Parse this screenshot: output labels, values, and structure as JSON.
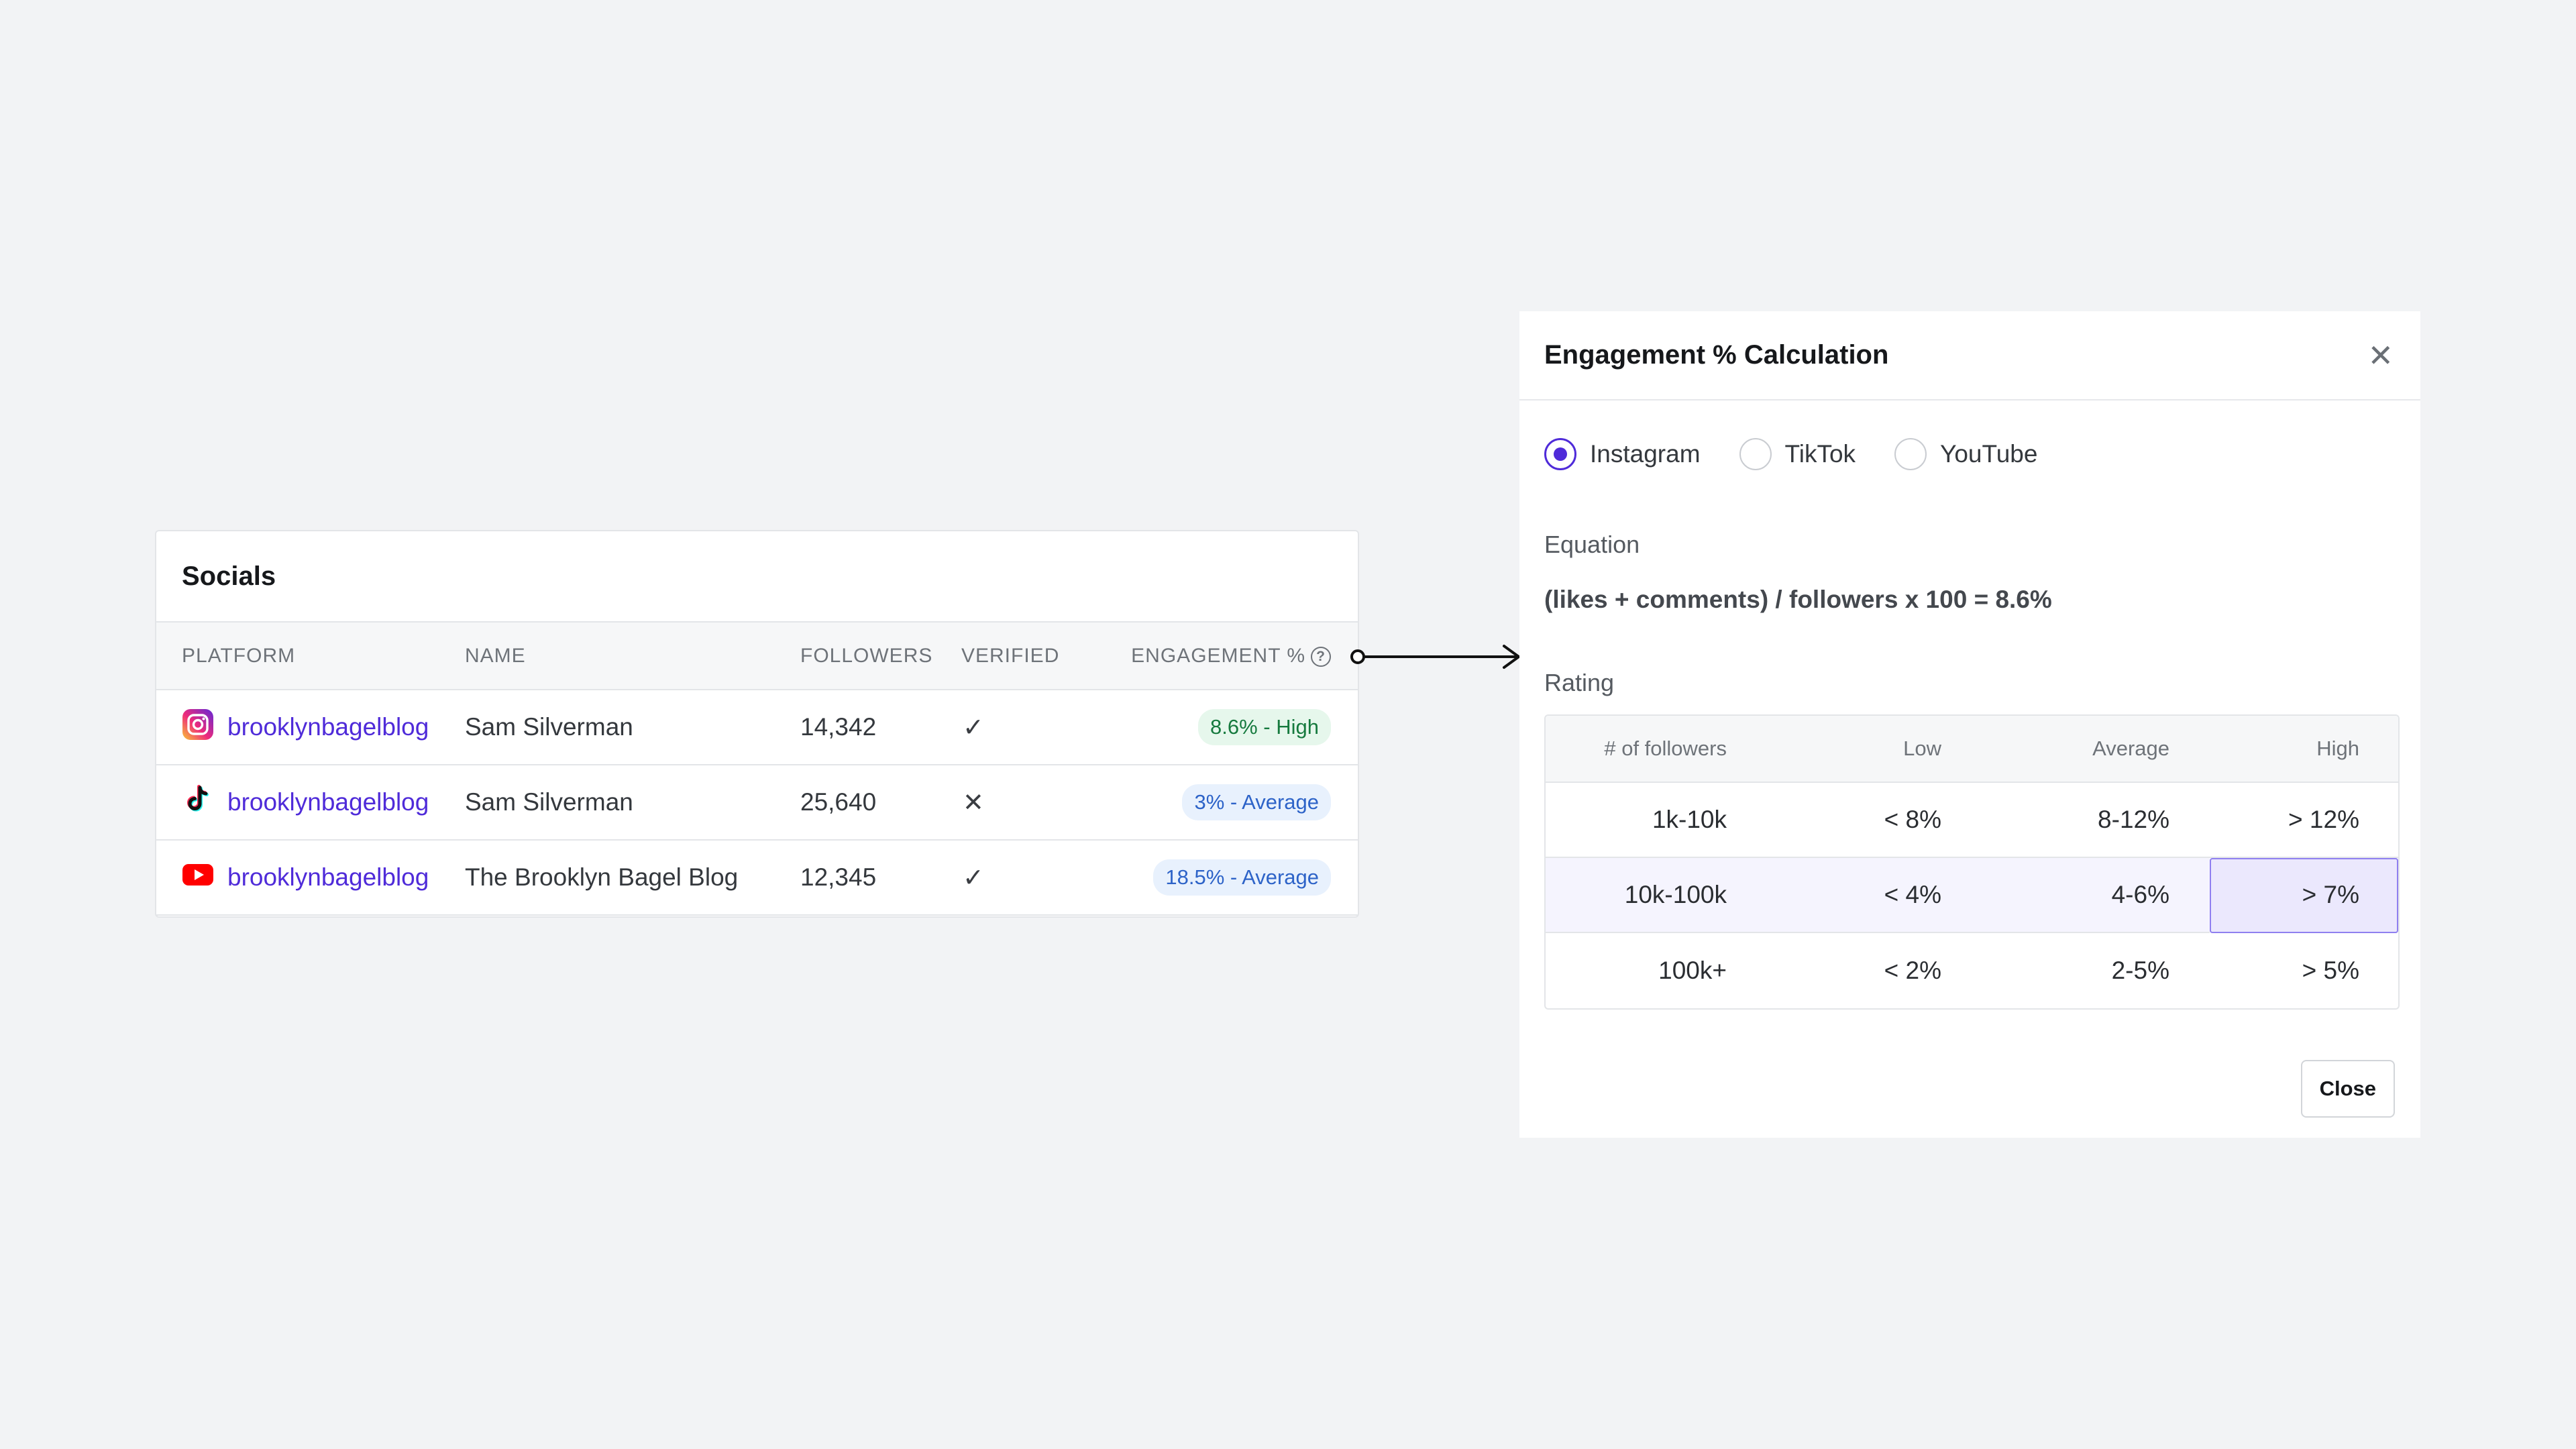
{
  "socials": {
    "title": "Socials",
    "columns": {
      "platform": "PLATFORM",
      "name": "NAME",
      "followers": "FOLLOWERS",
      "verified": "VERIFIED",
      "engagement": "ENGAGEMENT %"
    },
    "rows": [
      {
        "platform_icon": "instagram-icon",
        "handle": "brooklynbagelblog",
        "name": "Sam Silverman",
        "followers": "14,342",
        "verified": "✓",
        "verified_state": true,
        "engagement": "8.6% - High",
        "engagement_level": "high"
      },
      {
        "platform_icon": "tiktok-icon",
        "handle": "brooklynbagelblog",
        "name": "Sam Silverman",
        "followers": "25,640",
        "verified": "✕",
        "verified_state": false,
        "engagement": "3% - Average",
        "engagement_level": "average"
      },
      {
        "platform_icon": "youtube-icon",
        "handle": "brooklynbagelblog",
        "name": "The Brooklyn Bagel Blog",
        "followers": "12,345",
        "verified": "✓",
        "verified_state": true,
        "engagement": "18.5% - Average",
        "engagement_level": "average"
      }
    ]
  },
  "modal": {
    "title": "Engagement % Calculation",
    "platform_options": [
      {
        "label": "Instagram",
        "checked": true
      },
      {
        "label": "TikTok",
        "checked": false
      },
      {
        "label": "YouTube",
        "checked": false
      }
    ],
    "equation_label": "Equation",
    "equation": "(likes + comments) / followers x 100 = 8.6%",
    "rating_label": "Rating",
    "rating_table": {
      "headers": [
        "# of followers",
        "Low",
        "Average",
        "High"
      ],
      "rows": [
        [
          "1k-10k",
          "< 8%",
          "8-12%",
          "> 12%"
        ],
        [
          "10k-100k",
          "< 4%",
          "4-6%",
          "> 7%"
        ],
        [
          "100k+",
          "< 2%",
          "2-5%",
          "> 5%"
        ]
      ]
    },
    "close_label": "Close"
  },
  "colors": {
    "accent": "#4f2bd9",
    "high_badge_bg": "#e6f7ec",
    "high_badge_text": "#167a3e",
    "average_badge_bg": "#e8f1fd",
    "average_badge_text": "#2d63c8",
    "highlight_cell": "#ebe8fd"
  }
}
